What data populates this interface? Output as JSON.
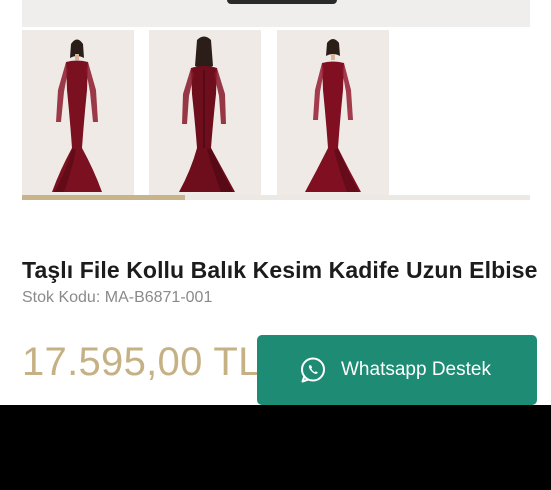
{
  "gallery": {
    "thumbnails": [
      {
        "icon": "dress-front-photo",
        "dress_color": "#7a1020"
      },
      {
        "icon": "dress-back-photo",
        "dress_color": "#6e0d1c"
      },
      {
        "icon": "dress-front-photo",
        "dress_color": "#800f22"
      }
    ],
    "scroll_progress": 0.32
  },
  "product": {
    "title": "Taşlı File Kollu Balık Kesim Kadife Uzun Elbise",
    "sku_label": "Stok Kodu:",
    "sku_value": "MA-B6871-001",
    "price": "17.595,00 TL"
  },
  "whatsapp": {
    "label": "Whatsapp Destek",
    "icon": "whatsapp-icon",
    "color": "#1e8b74"
  },
  "colors": {
    "accent_gold": "#c5b184",
    "title_text": "#1c1c1c",
    "muted_text": "#8a8a8a"
  }
}
